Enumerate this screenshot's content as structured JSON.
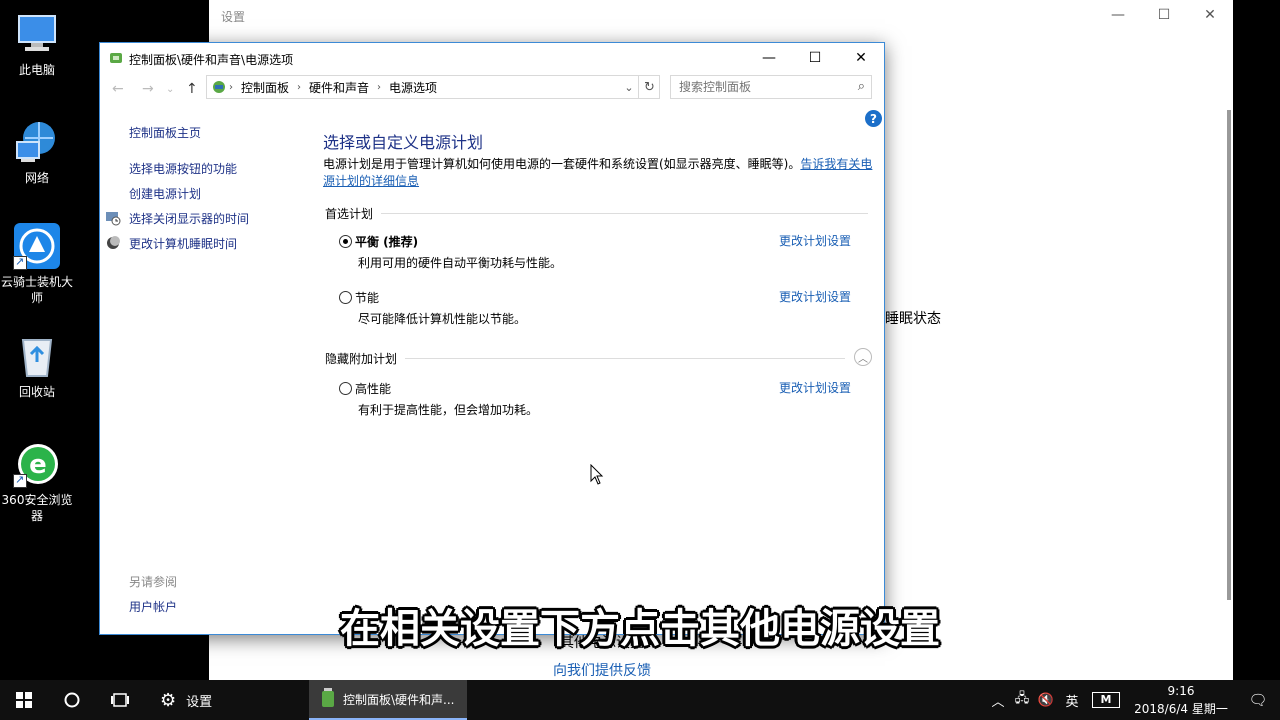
{
  "desktop": {
    "icons": [
      {
        "label": "此电脑",
        "icon": "computer-icon"
      },
      {
        "label": "网络",
        "icon": "network-icon"
      },
      {
        "label": "云骑士装机大师",
        "icon": "knight-app-icon"
      },
      {
        "label": "回收站",
        "icon": "recycle-bin-icon"
      },
      {
        "label": "360安全浏览器",
        "icon": "browser-360-icon"
      }
    ]
  },
  "settings_window": {
    "title": "设置",
    "sleep_text": "睡眠状态",
    "behind_text": "其他电源设置",
    "feedback_link": "向我们提供反馈"
  },
  "cp_window": {
    "title": "控制面板\\硬件和声音\\电源选项",
    "breadcrumb": [
      "控制面板",
      "硬件和声音",
      "电源选项"
    ],
    "search_placeholder": "搜索控制面板",
    "left_nav": {
      "home": "控制面板主页",
      "items": [
        "选择电源按钮的功能",
        "创建电源计划",
        "选择关闭显示器的时间",
        "更改计算机睡眠时间"
      ],
      "see_also": "另请参阅",
      "user_accounts": "用户帐户"
    },
    "main": {
      "title": "选择或自定义电源计划",
      "desc": "电源计划是用于管理计算机如何使用电源的一套硬件和系统设置(如显示器亮度、睡眠等)。",
      "desc_link": "告诉我有关电源计划的详细信息",
      "preferred_header": "首选计划",
      "hidden_header": "隐藏附加计划",
      "change_link": "更改计划设置",
      "plans": [
        {
          "name": "平衡 (推荐)",
          "desc": "利用可用的硬件自动平衡功耗与性能。",
          "selected": true
        },
        {
          "name": "节能",
          "desc": "尽可能降低计算机性能以节能。",
          "selected": false
        }
      ],
      "hidden_plans": [
        {
          "name": "高性能",
          "desc": "有利于提高性能，但会增加功耗。",
          "selected": false
        }
      ]
    }
  },
  "subtitle": "在相关设置下方点击其他电源设置",
  "taskbar": {
    "settings_label": "设置",
    "cp_label": "控制面板\\硬件和声...",
    "ime": "英",
    "time": "9:16",
    "date": "2018/6/4 星期一"
  }
}
